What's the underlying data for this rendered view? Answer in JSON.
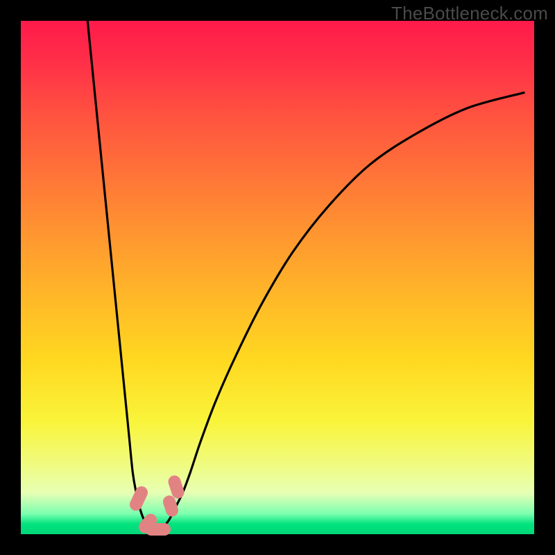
{
  "watermark": "TheBottleneck.com",
  "chart_data": {
    "type": "line",
    "title": "",
    "xlabel": "",
    "ylabel": "",
    "xlim": [
      0,
      100
    ],
    "ylim": [
      0,
      100
    ],
    "series": [
      {
        "name": "curve-left",
        "x": [
          13,
          14,
          15,
          16,
          17,
          18,
          19,
          20,
          21,
          21.8,
          22.5,
          23.2,
          24,
          24.8
        ],
        "values": [
          100,
          90,
          80,
          70,
          60,
          50,
          40,
          30,
          20,
          12,
          8,
          5,
          2.8,
          1.6
        ]
      },
      {
        "name": "curve-right",
        "x": [
          28,
          29,
          30,
          31.5,
          33,
          35,
          38,
          42,
          47,
          53,
          60,
          68,
          77,
          87,
          98
        ],
        "values": [
          1.6,
          3,
          5,
          8,
          12,
          18,
          26,
          35,
          45,
          55,
          64,
          72,
          78,
          83,
          86
        ]
      }
    ],
    "markers": [
      {
        "name": "marker-left-upper",
        "cx": 23.0,
        "cy": 7.0,
        "w": 2.4,
        "h": 5.0,
        "angle": 25
      },
      {
        "name": "marker-left-lower",
        "cx": 24.7,
        "cy": 2.1,
        "w": 2.4,
        "h": 4.2,
        "angle": 40
      },
      {
        "name": "marker-center",
        "cx": 26.7,
        "cy": 0.9,
        "w": 5.0,
        "h": 2.4,
        "angle": 0
      },
      {
        "name": "marker-right-lower",
        "cx": 29.2,
        "cy": 5.5,
        "w": 2.4,
        "h": 4.2,
        "angle": -18
      },
      {
        "name": "marker-right-upper",
        "cx": 30.2,
        "cy": 9.2,
        "w": 2.4,
        "h": 4.6,
        "angle": -18
      }
    ]
  }
}
